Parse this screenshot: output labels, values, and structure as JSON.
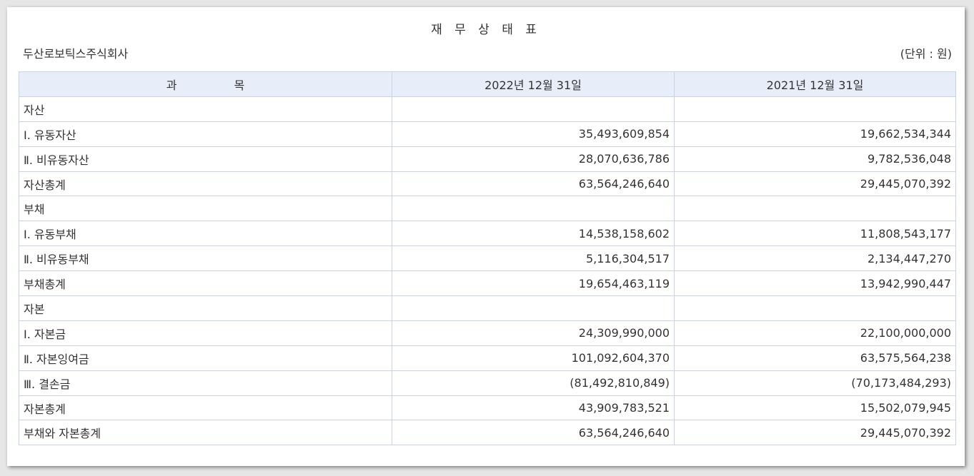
{
  "document": {
    "title": "재 무 상 태 표",
    "company": "두산로보틱스주식회사",
    "unit": "(단위 : 원)"
  },
  "table": {
    "headers": {
      "subject_part1": "과",
      "subject_part2": "목",
      "col_2022": "2022년 12월 31일",
      "col_2021": "2021년 12월 31일"
    },
    "rows": [
      {
        "label": "자산",
        "v2022": "",
        "v2021": ""
      },
      {
        "label": "Ⅰ. 유동자산",
        "v2022": "35,493,609,854",
        "v2021": "19,662,534,344"
      },
      {
        "label": "Ⅱ. 비유동자산",
        "v2022": "28,070,636,786",
        "v2021": "9,782,536,048"
      },
      {
        "label": "자산총계",
        "v2022": "63,564,246,640",
        "v2021": "29,445,070,392"
      },
      {
        "label": "부채",
        "v2022": "",
        "v2021": ""
      },
      {
        "label": "Ⅰ. 유동부채",
        "v2022": "14,538,158,602",
        "v2021": "11,808,543,177"
      },
      {
        "label": "Ⅱ. 비유동부채",
        "v2022": "5,116,304,517",
        "v2021": "2,134,447,270"
      },
      {
        "label": "부채총계",
        "v2022": "19,654,463,119",
        "v2021": "13,942,990,447"
      },
      {
        "label": "자본",
        "v2022": "",
        "v2021": ""
      },
      {
        "label": "Ⅰ. 자본금",
        "v2022": "24,309,990,000",
        "v2021": "22,100,000,000"
      },
      {
        "label": "Ⅱ. 자본잉여금",
        "v2022": "101,092,604,370",
        "v2021": "63,575,564,238"
      },
      {
        "label": "Ⅲ. 결손금",
        "v2022": "(81,492,810,849)",
        "v2021": "(70,173,484,293)"
      },
      {
        "label": "자본총계",
        "v2022": "43,909,783,521",
        "v2021": "15,502,079,945"
      },
      {
        "label": "부채와 자본총계",
        "v2022": "63,564,246,640",
        "v2021": "29,445,070,392"
      }
    ]
  }
}
